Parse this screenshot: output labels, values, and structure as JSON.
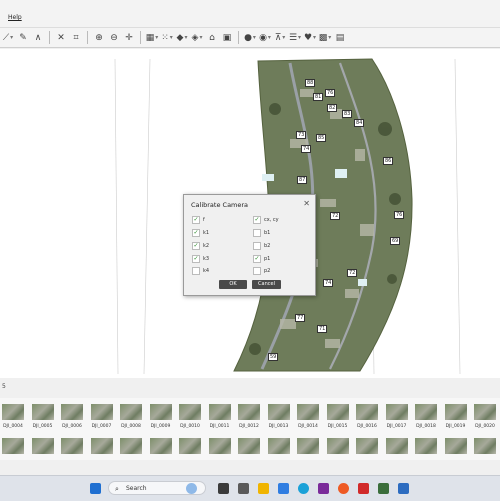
{
  "menu": {
    "help_label": "Help"
  },
  "toolbar": {
    "groups": [
      [
        "vector-icon",
        "pencil-icon",
        "angle-icon"
      ],
      [
        "close-x-icon",
        "crop-icon"
      ],
      [
        "zoom-in-icon",
        "zoom-out-icon",
        "crosshair-icon"
      ],
      [
        "grid-icon",
        "dots-grid-icon",
        "diamond-icon",
        "diamond-layers-icon",
        "tag-icon",
        "map-icon"
      ],
      [
        "globe-icon",
        "camera-icon",
        "tripod-icon",
        "list-icon",
        "heart-icon",
        "image-icon",
        "grid-table-icon"
      ]
    ]
  },
  "dialog": {
    "title": "Calibrate Camera",
    "left_options": [
      {
        "label": "f",
        "checked": true
      },
      {
        "label": "k1",
        "checked": true
      },
      {
        "label": "k2",
        "checked": true
      },
      {
        "label": "k3",
        "checked": true
      },
      {
        "label": "k4",
        "checked": false
      }
    ],
    "right_options": [
      {
        "label": "cx, cy",
        "checked": true
      },
      {
        "label": "b1",
        "checked": false
      },
      {
        "label": "b2",
        "checked": false
      },
      {
        "label": "p1",
        "checked": true
      },
      {
        "label": "p2",
        "checked": false
      }
    ],
    "ok_label": "OK",
    "cancel_label": "Cancel"
  },
  "map_markers": [
    "88",
    "76",
    "81",
    "82",
    "83",
    "84",
    "85",
    "73",
    "74",
    "86",
    "87",
    "79",
    "72",
    "76",
    "69",
    "72",
    "74",
    "77",
    "71",
    "59"
  ],
  "photos": {
    "header": "5",
    "row1": [
      "DJI_0004",
      "DJI_0005",
      "DJI_0006",
      "DJI_0007",
      "DJI_0008",
      "DJI_0009",
      "DJI_0010",
      "DJI_0011",
      "DJI_0012",
      "DJI_0013",
      "DJI_0014",
      "DJI_0015",
      "DJI_0016",
      "DJI_0017",
      "DJI_0018",
      "DJI_0019",
      "DJI_0020"
    ]
  },
  "taskbar": {
    "search_placeholder": "Search"
  }
}
